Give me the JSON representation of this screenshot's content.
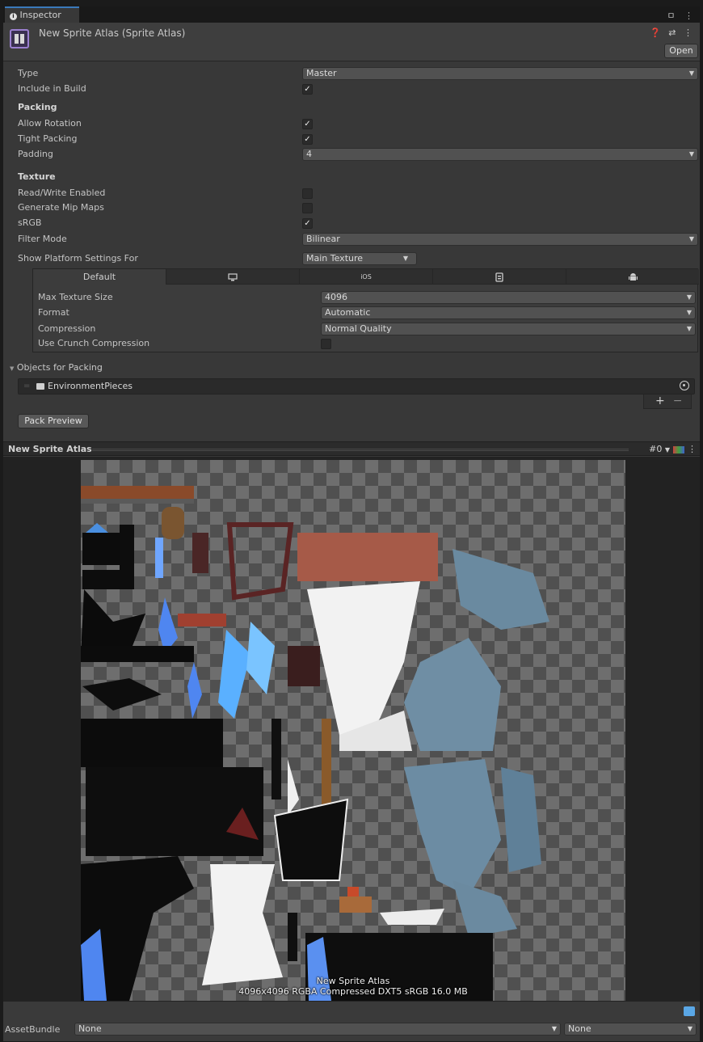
{
  "window": {
    "tab_label": "Inspector",
    "tab_icon": "info-icon",
    "tab_menu": "⋮"
  },
  "header": {
    "title": "New Sprite Atlas (Sprite Atlas)",
    "open_label": "Open",
    "icons": "❓ ⇄ ⋮"
  },
  "settings": {
    "type_label": "Type",
    "type_value": "Master",
    "include_label": "Include in Build",
    "include_checked": true,
    "packing_header": "Packing",
    "allow_rotation_label": "Allow Rotation",
    "allow_rotation_checked": true,
    "tight_packing_label": "Tight Packing",
    "tight_packing_checked": true,
    "padding_label": "Padding",
    "padding_value": "4",
    "texture_header": "Texture",
    "read_write_label": "Read/Write Enabled",
    "read_write_checked": false,
    "mip_label": "Generate Mip Maps",
    "mip_checked": false,
    "srgb_label": "sRGB",
    "srgb_checked": true,
    "filter_label": "Filter Mode",
    "filter_value": "Bilinear",
    "platform_label": "Show Platform Settings For",
    "platform_value": "Main Texture"
  },
  "platform": {
    "tabs": [
      {
        "label": "Default",
        "icon": ""
      },
      {
        "label": "",
        "icon": "monitor-icon"
      },
      {
        "label": "iOS",
        "icon": ""
      },
      {
        "label": "",
        "icon": "webgl-icon"
      },
      {
        "label": "",
        "icon": "android-icon"
      }
    ],
    "max_size_label": "Max Texture Size",
    "max_size_value": "4096",
    "format_label": "Format",
    "format_value": "Automatic",
    "compression_label": "Compression",
    "compression_value": "Normal Quality",
    "crunch_label": "Use Crunch Compression",
    "crunch_checked": false
  },
  "objects": {
    "header": "Objects for Packing",
    "items": [
      "EnvironmentPieces"
    ],
    "add_label": "+",
    "remove_label": "−"
  },
  "pack_preview_label": "Pack Preview",
  "preview": {
    "title": "New Sprite Atlas",
    "page_index": "#0",
    "atlas_name": "New Sprite Atlas",
    "atlas_info": "4096x4096 RGBA Compressed DXT5 sRGB  16.0 MB"
  },
  "footer": {
    "assetbundle_label": "AssetBundle",
    "bundle_value": "None",
    "variant_value": "None"
  }
}
